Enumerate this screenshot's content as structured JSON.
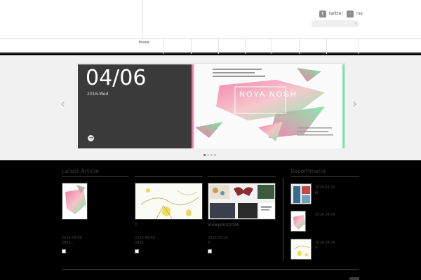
{
  "header": {
    "social": [
      {
        "icon": "twitter-icon",
        "glyph": "t",
        "label": "twitter"
      },
      {
        "icon": "rss-icon",
        "glyph": "◦",
        "label": "rss"
      }
    ],
    "search": {
      "placeholder": "",
      "go_glyph": "›"
    }
  },
  "nav": {
    "items": [
      {
        "label": "Home"
      },
      {
        "label": ""
      },
      {
        "label": ""
      },
      {
        "label": ""
      },
      {
        "label": ""
      },
      {
        "label": ""
      },
      {
        "label": ""
      },
      {
        "label": ""
      }
    ]
  },
  "slider": {
    "date": "04/06",
    "day": "2016-Wed",
    "more_glyph": "→",
    "prev_glyph": "‹",
    "next_glyph": "›",
    "dots": 4,
    "active_dot": 0,
    "art_label": "NOYA NOSH"
  },
  "latest": {
    "title": "Latest Article",
    "articles": [
      {
        "title": "",
        "date": "2016.04.06",
        "excerpt": "2011..."
      },
      {
        "title": "Y",
        "date": "2016.04.06",
        "excerpt": "2012"
      },
      {
        "title": "Viewpoint2016",
        "date": "2016.03.20",
        "excerpt": "3"
      }
    ]
  },
  "recommend": {
    "title": "Recommend",
    "items": [
      {
        "date": "2016.03.10",
        "title": "H"
      },
      {
        "date": "2016.04.06",
        "title": ""
      },
      {
        "date": "2016.04.06",
        "title": "Y"
      }
    ]
  },
  "colors": {
    "accent_green": "#7ee6a4",
    "accent_pink": "#f07aa8",
    "slide_dark": "#3a3a3a"
  }
}
